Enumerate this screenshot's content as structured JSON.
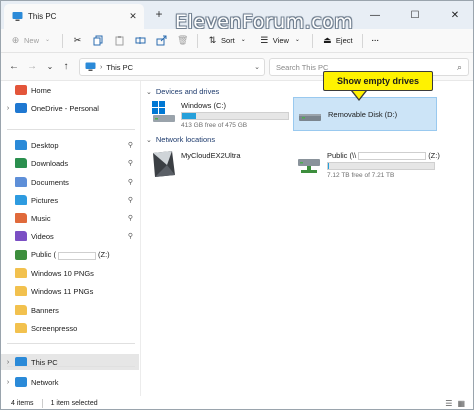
{
  "watermark": "ElevenForum.com",
  "tab": {
    "title": "This PC",
    "close": "✕",
    "new": "+"
  },
  "window_controls": {
    "minimize": "—",
    "maximize": "☐",
    "close": "✕"
  },
  "commandbar": {
    "new": "New",
    "sort": "Sort",
    "view": "View",
    "eject": "Eject",
    "more": "···"
  },
  "address": {
    "path": "This PC",
    "search_placeholder": "Search This PC"
  },
  "sidebar": {
    "items": [
      {
        "label": "Home",
        "icon": "home-icon",
        "color": "#e3553a"
      },
      {
        "label": "OneDrive - Personal",
        "icon": "onedrive-icon",
        "color": "#1f78d1"
      },
      {
        "label": "Desktop",
        "icon": "desktop-folder-icon",
        "color": "#2b8ad8",
        "pinned": "pin-icon"
      },
      {
        "label": "Downloads",
        "icon": "downloads-folder-icon",
        "color": "#2a8f4e",
        "pinned": "pin-icon"
      },
      {
        "label": "Documents",
        "icon": "documents-folder-icon",
        "color": "#5e8fd8",
        "pinned": "pin-icon"
      },
      {
        "label": "Pictures",
        "icon": "pictures-folder-icon",
        "color": "#2e9be0",
        "pinned": "pin-icon"
      },
      {
        "label": "Music",
        "icon": "music-folder-icon",
        "color": "#e06a3b",
        "pinned": "pin-icon"
      },
      {
        "label": "Videos",
        "icon": "videos-folder-icon",
        "color": "#7b4fc4",
        "pinned": "pin-icon"
      },
      {
        "label_prefix": "Public (",
        "label_suffix": "(Z:)",
        "icon": "network-drive-icon",
        "color": "#3d8e3d"
      },
      {
        "label": "Windows 10 PNGs",
        "icon": "folder-icon",
        "color": "#f2c14e"
      },
      {
        "label": "Windows 11 PNGs",
        "icon": "folder-icon",
        "color": "#f2c14e"
      },
      {
        "label": "Banners",
        "icon": "folder-icon",
        "color": "#f2c14e"
      },
      {
        "label": "Screenpresso",
        "icon": "folder-icon",
        "color": "#f2c14e"
      },
      {
        "label": "This PC",
        "icon": "this-pc-icon",
        "color": "#2b8ad8",
        "selected": true
      },
      {
        "label": "Network",
        "icon": "network-icon",
        "color": "#2b8ad8"
      }
    ]
  },
  "groups": {
    "devices": "Devices and drives",
    "network": "Network locations"
  },
  "drives": {
    "c": {
      "name": "Windows (C:)",
      "free": "413 GB free of 475 GB",
      "used_fraction": 0.13,
      "fill_color": "#26a0da"
    },
    "d": {
      "name": "Removable Disk (D:)"
    },
    "mycloud": {
      "name": "MyCloudEX2Ultra"
    },
    "public": {
      "name_prefix": "Public (\\\\",
      "name_suffix": "(Z:)",
      "free": "7.12 TB free of 7.21 TB",
      "used_fraction": 0.01,
      "fill_color": "#26a0da"
    }
  },
  "callout": "Show empty drives",
  "status": {
    "items": "4 items",
    "selected": "1 item selected"
  }
}
